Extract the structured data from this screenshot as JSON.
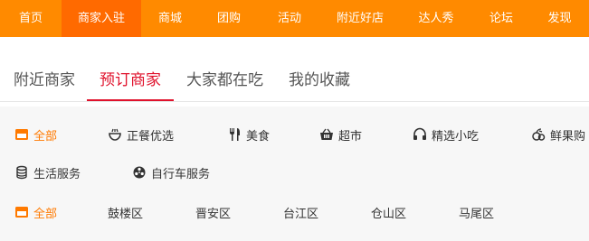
{
  "topnav": {
    "items": [
      {
        "label": "首页"
      },
      {
        "label": "商家入驻"
      },
      {
        "label": "商城"
      },
      {
        "label": "团购"
      },
      {
        "label": "活动"
      },
      {
        "label": "附近好店"
      },
      {
        "label": "达人秀"
      },
      {
        "label": "论坛"
      },
      {
        "label": "发现"
      }
    ],
    "active_index": 1,
    "colors": {
      "bar": "#ff8a00",
      "active": "#ff6a00"
    }
  },
  "tabs": {
    "items": [
      {
        "label": "附近商家"
      },
      {
        "label": "预订商家"
      },
      {
        "label": "大家都在吃"
      },
      {
        "label": "我的收藏"
      }
    ],
    "active_index": 1,
    "active_color": "#e0122c"
  },
  "categories": {
    "items": [
      {
        "label": "全部",
        "icon": "grid-box-icon",
        "active": true
      },
      {
        "label": "正餐优选",
        "icon": "bowl-icon"
      },
      {
        "label": "美食",
        "icon": "fork-knife-icon"
      },
      {
        "label": "超市",
        "icon": "shopping-basket-icon"
      },
      {
        "label": "精选小吃",
        "icon": "headset-icon"
      },
      {
        "label": "鲜果购",
        "icon": "fruit-icon"
      },
      {
        "label": "生活服务",
        "icon": "coins-icon"
      },
      {
        "label": "自行车服务",
        "icon": "wheel-icon"
      }
    ],
    "accent_color": "#ff7a00"
  },
  "districts": {
    "items": [
      {
        "label": "全部",
        "icon": "grid-box-icon",
        "active": true
      },
      {
        "label": "鼓楼区"
      },
      {
        "label": "晋安区"
      },
      {
        "label": "台江区"
      },
      {
        "label": "仓山区"
      },
      {
        "label": "马尾区"
      }
    ]
  }
}
